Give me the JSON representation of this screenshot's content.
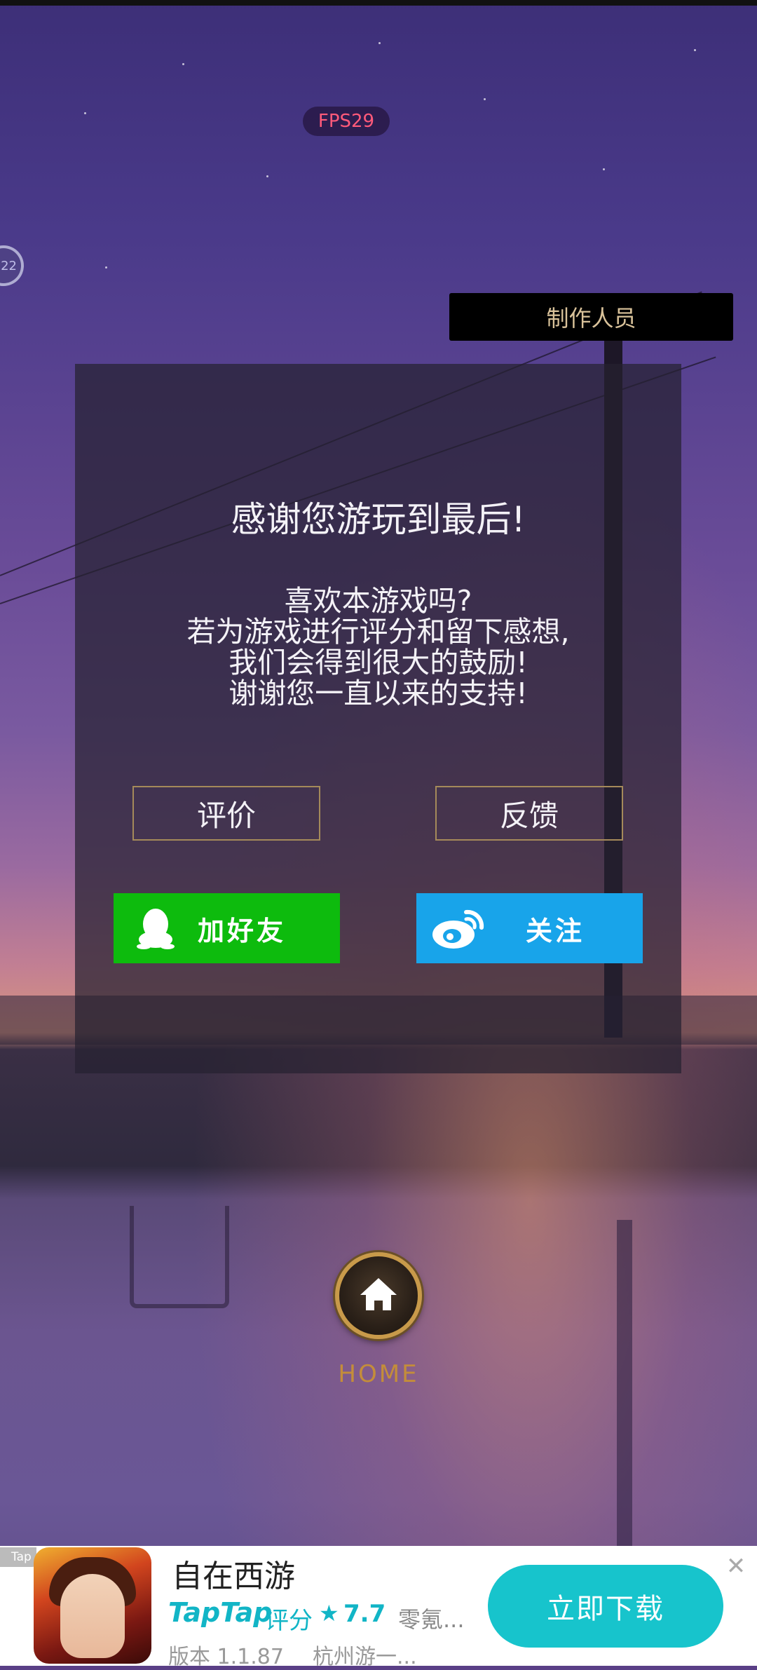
{
  "hud": {
    "fps": "FPS29",
    "side_float": "22"
  },
  "credits_label": "制作人员",
  "dialog": {
    "title": "感谢您游玩到最后!",
    "message_lines": [
      "喜欢本游戏吗?",
      "若为游戏进行评分和留下感想,",
      "我们会得到很大的鼓励!",
      "谢谢您一直以来的支持!"
    ],
    "rate_label": "评价",
    "feedback_label": "反馈",
    "add_friend_label": "加好友",
    "follow_label": "关注"
  },
  "home_label": "HOME",
  "ad": {
    "tag": "Tap",
    "title": "自在西游",
    "brand": "TapTap",
    "score_label": "评分",
    "star": "★",
    "score": "7.7",
    "desc": "零氪...",
    "version": "版本 1.1.87",
    "developer": "杭州游一...",
    "download_label": "立即下载",
    "close": "✕"
  },
  "colors": {
    "qq_green": "#0dbb0d",
    "weibo_blue": "#18a4ea",
    "taptap_cyan": "#17c4cc",
    "fps_red": "#ff5a7a"
  }
}
